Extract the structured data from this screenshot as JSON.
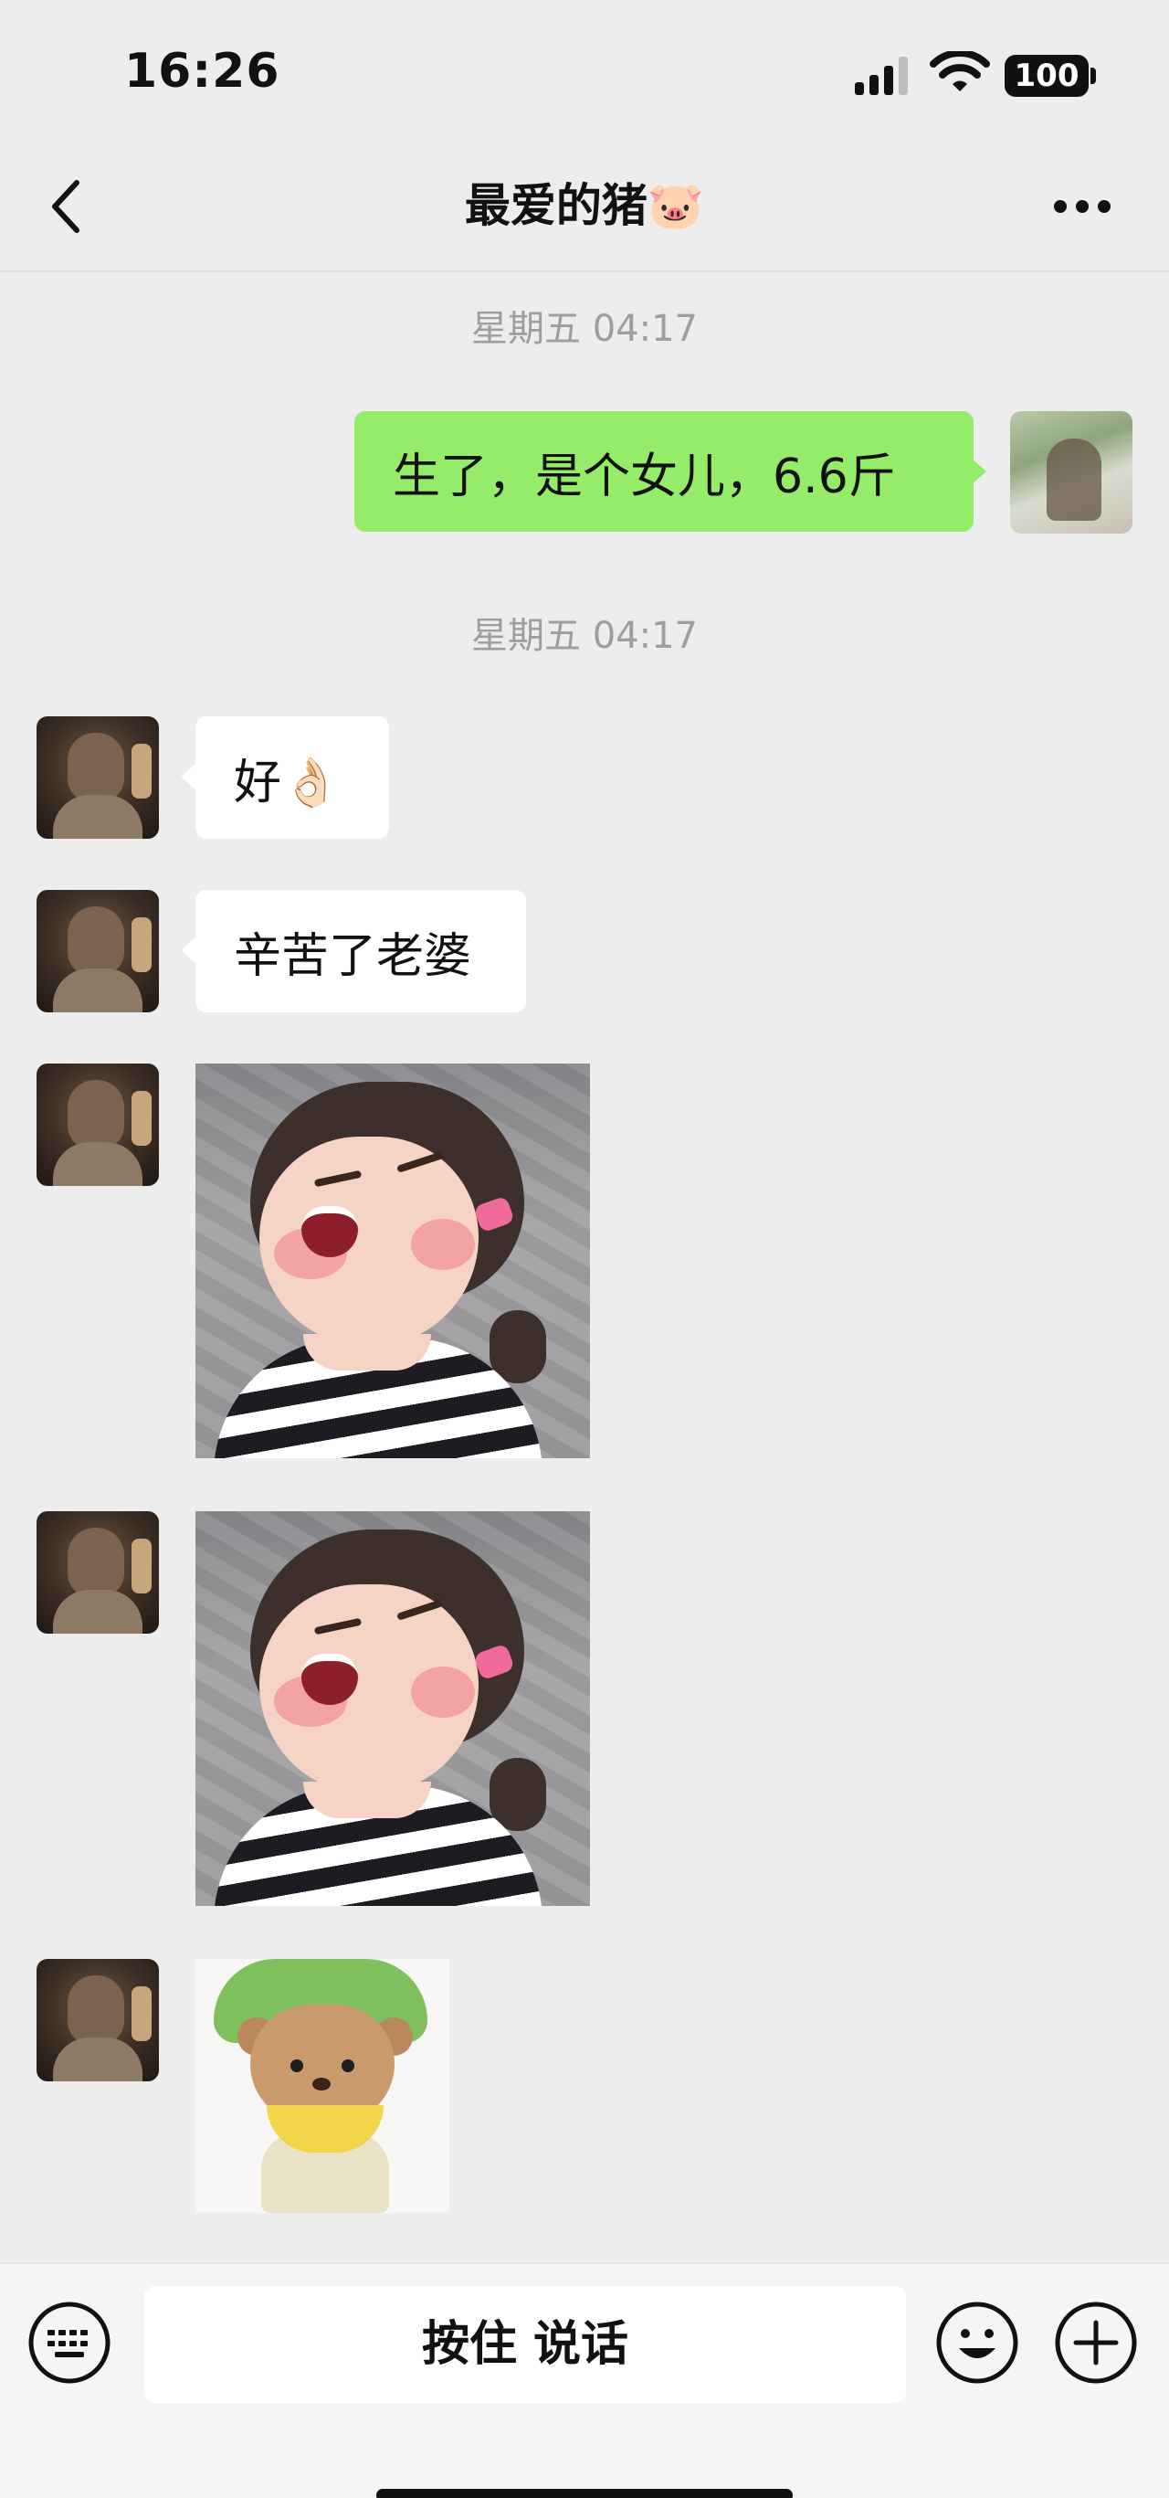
{
  "status_bar": {
    "time": "16:26",
    "battery": "100",
    "signal_icon": "signal-icon",
    "wifi_icon": "wifi-icon"
  },
  "nav": {
    "title": "最爱的猪🐷",
    "back_icon": "chevron-left-icon",
    "more_icon": "more-icon"
  },
  "messages": {
    "timestamp_1": "星期五 04:17",
    "me_1": "生了，是个女儿，6.6斤",
    "timestamp_2": "星期五 04:17",
    "other_1": "好👌🏻",
    "other_2": "辛苦了老婆",
    "sticker_1": "laughing-girl-sticker",
    "sticker_2": "laughing-girl-sticker",
    "sticker_3": "bear-sticker"
  },
  "input_bar": {
    "voice_label": "按住 说话",
    "keyboard_icon": "keyboard-icon",
    "emoji_icon": "emoji-icon",
    "plus_icon": "plus-icon"
  },
  "colors": {
    "background": "#ededed",
    "bubble_me": "#95ec69",
    "bubble_other": "#ffffff",
    "timestamp_text": "#9e9e9e"
  }
}
